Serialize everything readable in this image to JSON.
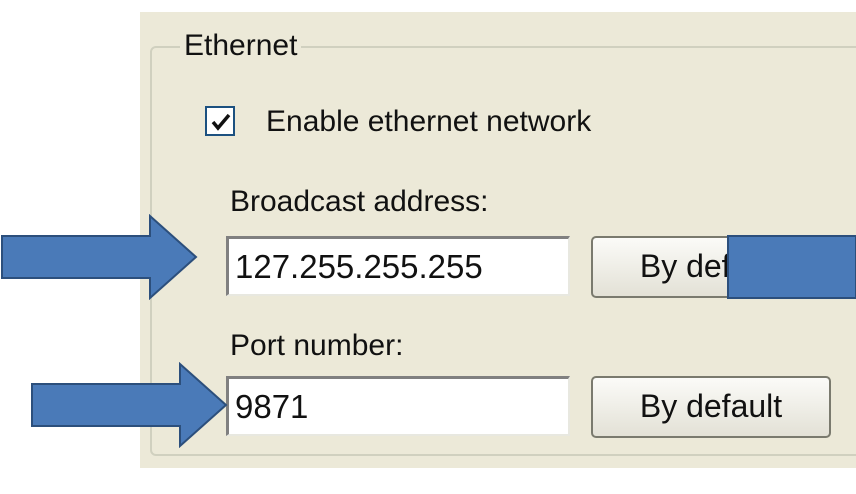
{
  "ethernet_group": {
    "title": "Ethernet",
    "enable_checkbox": {
      "label": "Enable ethernet network",
      "checked": true
    },
    "broadcast": {
      "label": "Broadcast address:",
      "value": "127.255.255.255",
      "default_button": "By default"
    },
    "port": {
      "label": "Port number:",
      "value": "9871",
      "default_button": "By default"
    }
  },
  "annotations": {
    "arrow_color": "#4a7ab8",
    "arrow_border": "#2c4f7c"
  }
}
